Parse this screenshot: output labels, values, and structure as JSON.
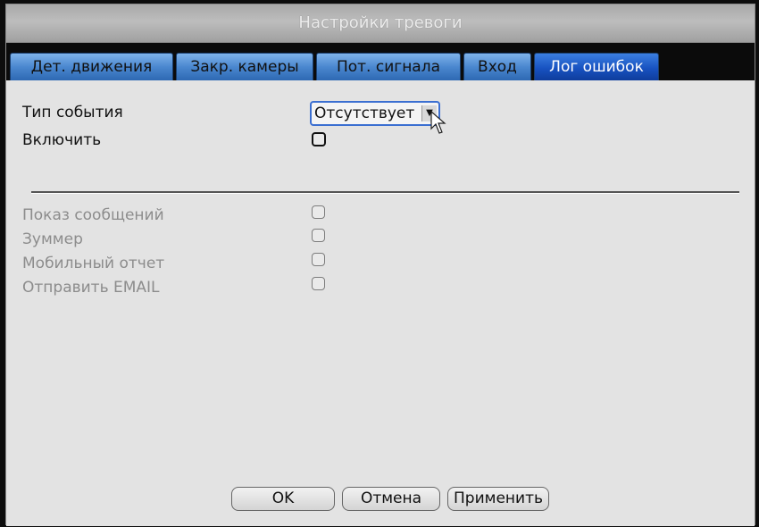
{
  "window": {
    "title": "Настройки тревоги"
  },
  "tabs": [
    {
      "label": "Дет. движения",
      "active": false
    },
    {
      "label": "Закр. камеры",
      "active": false
    },
    {
      "label": "Пот. сигнала",
      "active": false
    },
    {
      "label": "Вход",
      "active": false
    },
    {
      "label": "Лог ошибок",
      "active": true
    }
  ],
  "form": {
    "event_type_label": "Тип события",
    "event_type_value": "Отсутствует",
    "enable_label": "Включить",
    "enable_checked": false
  },
  "options": [
    {
      "label": "Показ сообщений",
      "checked": false,
      "enabled": false
    },
    {
      "label": "Зуммер",
      "checked": false,
      "enabled": false
    },
    {
      "label": "Мобильный отчет",
      "checked": false,
      "enabled": false
    },
    {
      "label": "Отправить EMAIL",
      "checked": false,
      "enabled": false
    }
  ],
  "buttons": {
    "ok": "OK",
    "cancel": "Отмена",
    "apply": "Применить"
  },
  "icons": {
    "dropdown": "chevron-down-icon",
    "cursor": "mouse-pointer-icon"
  },
  "colors": {
    "tab": "#4a87cf",
    "tab_active": "#1852c1",
    "tab_bar": "#0b0b0b",
    "panel": "#e3e3e3"
  }
}
